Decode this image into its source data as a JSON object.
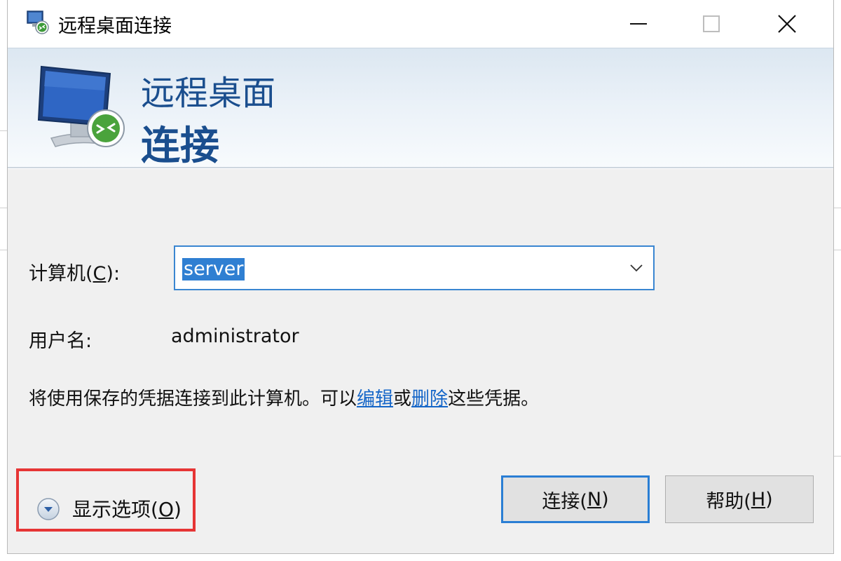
{
  "window": {
    "title": "远程桌面连接",
    "minimize_icon": "minimize-icon",
    "maximize_icon": "maximize-icon",
    "close_icon": "close-icon"
  },
  "banner": {
    "line1": "远程桌面",
    "line2": "连接",
    "icon": "remote-desktop-monitor-icon"
  },
  "form": {
    "computer_label": "计算机(",
    "computer_accel": "C",
    "computer_label_end": "):",
    "computer_value": "server",
    "username_label": "用户名:",
    "username_value": "administrator"
  },
  "info": {
    "prefix": "将使用保存的凭据连接到此计算机。可以",
    "edit_link": "编辑",
    "middle": "或",
    "delete_link": "删除",
    "suffix": "这些凭据。"
  },
  "footer": {
    "options_label": "显示选项(",
    "options_accel": "O",
    "options_end": ")",
    "connect_label": "连接(",
    "connect_accel": "N",
    "connect_end": ")",
    "help_label": "帮助(",
    "help_accel": "H",
    "help_end": ")"
  },
  "colors": {
    "accent": "#2a7ed4",
    "banner_text": "#1a4e8e",
    "link": "#1566c8",
    "highlight_box": "#e63535"
  }
}
